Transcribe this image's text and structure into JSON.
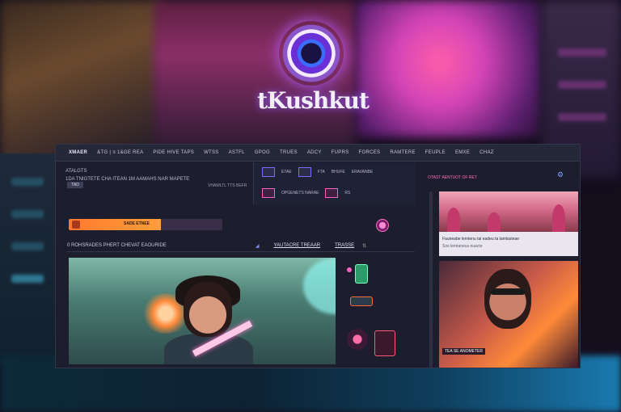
{
  "logo": {
    "text": "tKushkut",
    "icon": "camera-lens-icon"
  },
  "nav": {
    "items": [
      "XMAER",
      "&TG | ≡ 1&GE REA",
      "PIDE HIVE TAPS",
      "WTSS",
      "ASTFL",
      "GPOG",
      "TRUES",
      "ADCY",
      "FUPRS",
      "FORCES",
      "RAMTERE",
      "FEUPLE",
      "EMXE",
      "CHAZ"
    ]
  },
  "info": {
    "line1": "ATALGTS",
    "line2": "1DA TNIGTETE CHA ITEAN 1M AAMAHS NAR MAPETE",
    "filter_badge": "TAD",
    "mid_link": "VHAWLTL TTS BEFR"
  },
  "icon_strip": {
    "row1": [
      "ETAE",
      "FTA",
      "BHUFE",
      "ERAVANBE"
    ],
    "row2": [
      "OPGENETS NARAE",
      "RS"
    ]
  },
  "sort": {
    "label": "OTAST AENTUOT OF RET"
  },
  "progress": {
    "label": "SADE ETNEE",
    "percent": 60
  },
  "list": {
    "title": "0 ROHSRADES PHERT CHEVAT EAOURIDE",
    "col1": "YAUTACRE TREAAR",
    "col2": "TRASSE",
    "sort_icon": "⇅"
  },
  "right_col": {
    "caption_line1": "Fauneabe lemtenu tai eadeu ta tamlasteae",
    "caption_line2": "Sos lemtaneus nuacte",
    "photo_label": "TEA SE ANOMETER"
  },
  "colors": {
    "accent": "#ff6ec4",
    "brand_blue": "#2a4cc8",
    "progress": "#ff7a2e"
  }
}
